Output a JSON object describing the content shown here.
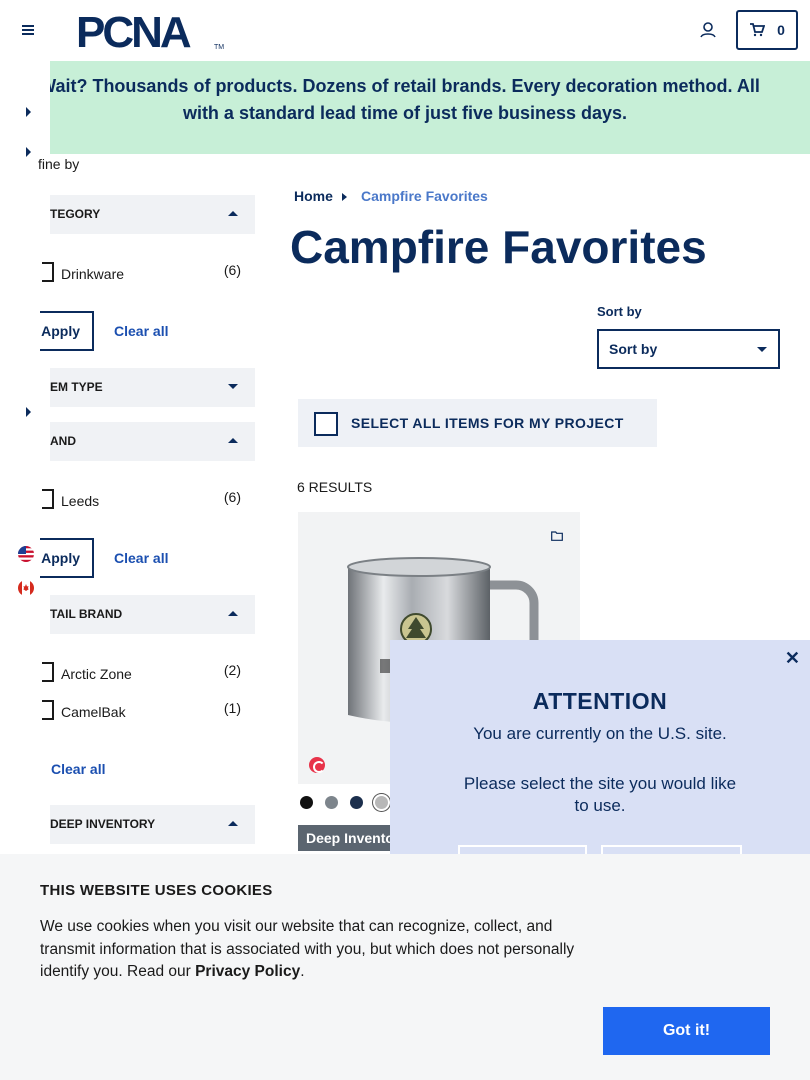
{
  "header": {
    "logo_text": "PCNA",
    "logo_tm": "TM",
    "cart_count": "0"
  },
  "banner": {
    "line1": "y Wait? Thousands of products. Dozens of retail brands. Every decoration method. All",
    "line2": "with a standard lead time of just five business days."
  },
  "filters": {
    "refine_label": "fine by",
    "sections": [
      {
        "label": "TEGORY",
        "caret": "up"
      },
      {
        "label": "EM TYPE",
        "caret": "down"
      },
      {
        "label": "AND",
        "caret": "up"
      },
      {
        "label": "TAIL BRAND",
        "caret": "up"
      },
      {
        "label": "DEEP INVENTORY",
        "caret": "up"
      }
    ],
    "category_options": [
      {
        "label": "Drinkware",
        "count": "(6)"
      }
    ],
    "brand_options": [
      {
        "label": "Leeds",
        "count": "(6)"
      }
    ],
    "retail_brand_options": [
      {
        "label": "Arctic Zone",
        "count": "(2)"
      },
      {
        "label": "CamelBak",
        "count": "(1)"
      }
    ],
    "apply_label": "Apply",
    "clear_label": "Clear all"
  },
  "breadcrumb": {
    "home": "Home",
    "current": "Campfire Favorites"
  },
  "page_title": "Campfire Favorites",
  "sort": {
    "label": "Sort by",
    "selected": "Sort by"
  },
  "select_all_label": "SELECT ALL ITEMS FOR MY PROJECT",
  "results_count": "6 RESULTS",
  "product": {
    "badge": "Deep Inventory",
    "swatches": [
      "#111111",
      "#7d858c",
      "#1c2f4d",
      "#b8b8b8"
    ]
  },
  "modal": {
    "title": "ATTENTION",
    "message1": "You are currently on the U.S. site.",
    "message2": "Please select the site you would like to use.",
    "close_glyph": "✕"
  },
  "cookie": {
    "title": "THIS WEBSITE USES COOKIES",
    "body": "We use cookies when you visit our website that can recognize, collect, and transmit information that is associated with you, but which does not personally identify you. Read our ",
    "link": "Privacy Policy",
    "end": ".",
    "button": "Got it!"
  },
  "colors": {
    "brand_navy": "#0b2b5c",
    "banner_bg": "#c7efd7",
    "modal_bg": "#d9e0f5",
    "accept_blue": "#1f67f0"
  }
}
